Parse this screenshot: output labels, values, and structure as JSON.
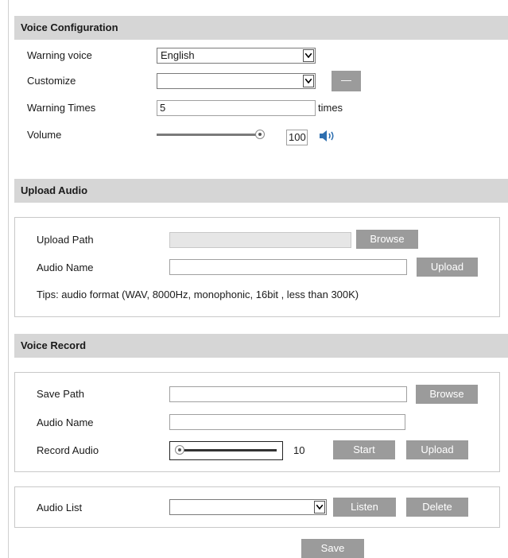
{
  "voice_config": {
    "header": "Voice Configuration",
    "warning_voice_label": "Warning voice",
    "warning_voice_value": "English",
    "customize_label": "Customize",
    "customize_value": "",
    "customize_button": "—",
    "warning_times_label": "Warning Times",
    "warning_times_value": "5",
    "warning_times_unit": "times",
    "volume_label": "Volume",
    "volume_value": "100",
    "volume_level": 1.0
  },
  "upload_audio": {
    "header": "Upload Audio",
    "upload_path_label": "Upload Path",
    "upload_path_value": "",
    "browse_button": "Browse",
    "audio_name_label": "Audio Name",
    "audio_name_value": "",
    "upload_button": "Upload",
    "tips": "Tips: audio format (WAV, 8000Hz, monophonic, 16bit , less than 300K)"
  },
  "voice_record": {
    "header": "Voice Record",
    "save_path_label": "Save Path",
    "save_path_value": "",
    "browse_button": "Browse",
    "audio_name_label": "Audio Name",
    "audio_name_value": "",
    "record_audio_label": "Record Audio",
    "record_value": "10",
    "record_level": 0.0,
    "start_button": "Start",
    "upload_button": "Upload",
    "audio_list_label": "Audio List",
    "audio_list_value": "",
    "listen_button": "Listen",
    "delete_button": "Delete"
  },
  "save_button": "Save",
  "icons": {
    "select_arrow": "chevron-down-icon",
    "volume": "speaker-icon"
  }
}
